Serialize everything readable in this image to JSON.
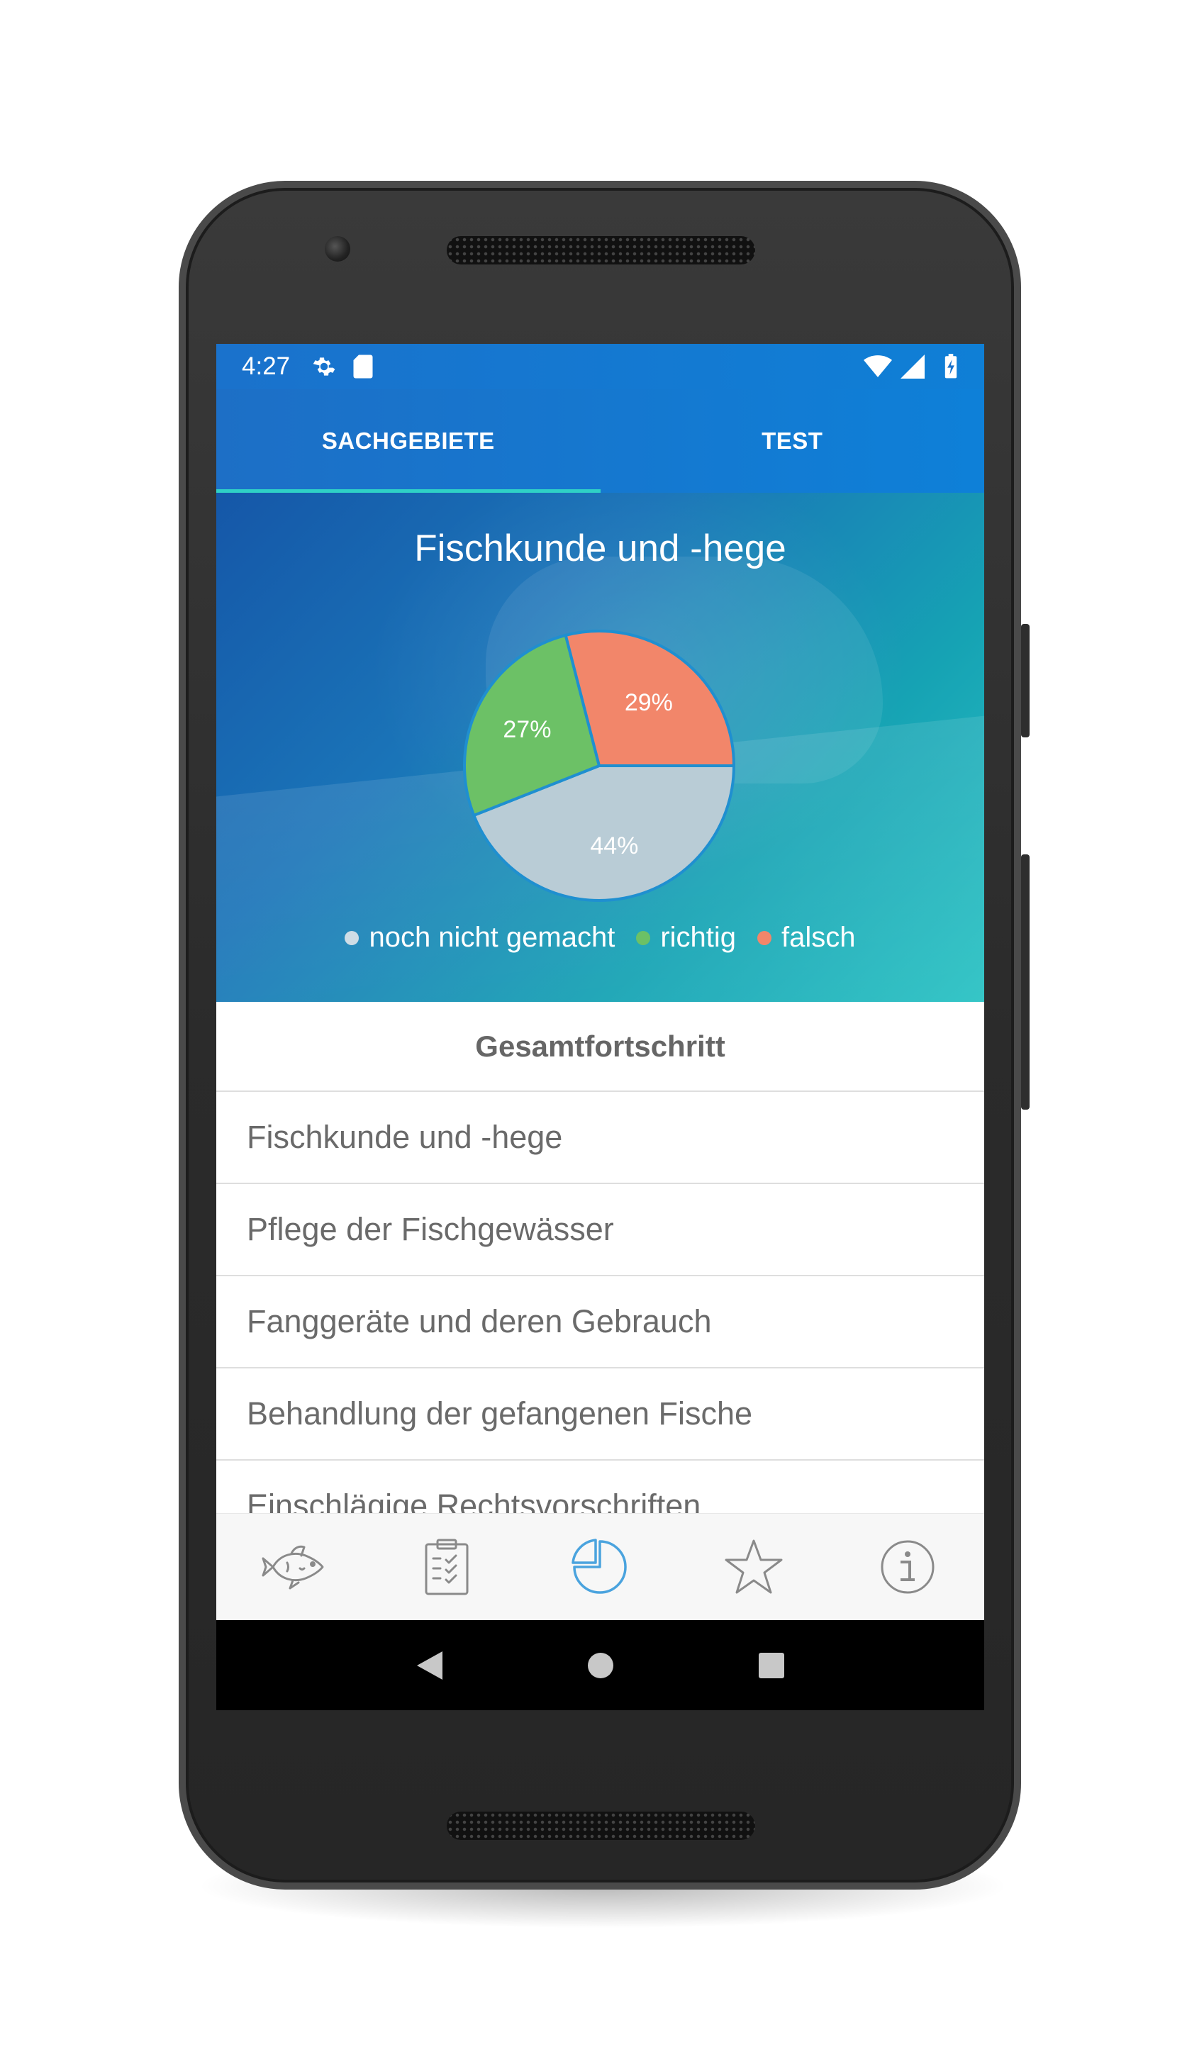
{
  "statusbar": {
    "time": "4:27"
  },
  "tabs": [
    {
      "label": "SACHGEBIETE",
      "active": true
    },
    {
      "label": "TEST",
      "active": false
    }
  ],
  "hero": {
    "title": "Fischkunde und -hege"
  },
  "chart_data": {
    "type": "pie",
    "title": "Fischkunde und -hege",
    "slices": [
      {
        "label": "noch nicht gemacht",
        "value": 44,
        "display": "44%",
        "color": "#b9ccd6"
      },
      {
        "label": "richtig",
        "value": 27,
        "display": "27%",
        "color": "#6cc166"
      },
      {
        "label": "falsch",
        "value": 29,
        "display": "29%",
        "color": "#f2866a"
      }
    ],
    "legend_position": "bottom"
  },
  "list": {
    "header": "Gesamtfortschritt",
    "items": [
      "Fischkunde und -hege",
      "Pflege der Fischgewässer",
      "Fanggeräte und deren Gebrauch",
      "Behandlung der gefangenen Fische",
      "Einschlägige Rechtsvorschriften"
    ]
  },
  "bottom_nav": [
    {
      "icon": "fish-icon",
      "active": false
    },
    {
      "icon": "clipboard-checklist-icon",
      "active": false
    },
    {
      "icon": "pie-chart-icon",
      "active": true
    },
    {
      "icon": "star-icon",
      "active": false
    },
    {
      "icon": "info-icon",
      "active": false
    }
  ],
  "colors": {
    "primary": "#1a72cc",
    "tab_indicator": "#2fd1c6",
    "active_nav": "#4aa3de",
    "inactive_nav": "#8a8a8a"
  }
}
